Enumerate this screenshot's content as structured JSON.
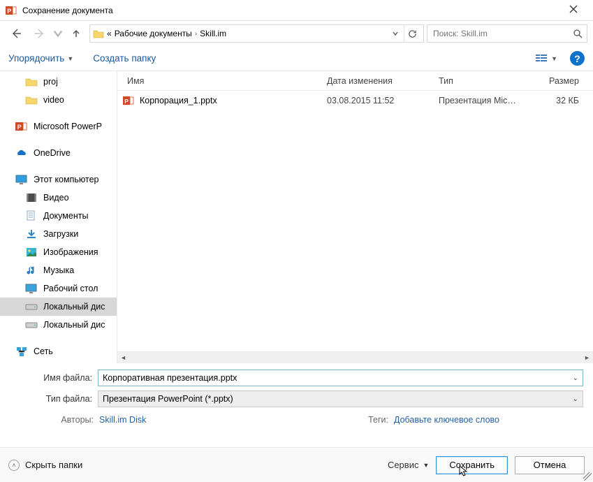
{
  "window": {
    "title": "Сохранение документа"
  },
  "nav": {
    "crumb_prefix": "«",
    "crumb1": "Рабочие документы",
    "crumb2": "Skill.im",
    "search_placeholder": "Поиск: Skill.im"
  },
  "toolbar": {
    "organize": "Упорядочить",
    "new_folder": "Создать папку",
    "help": "?"
  },
  "tree": {
    "n_proj": "proj",
    "n_video": "video",
    "n_ppt": "Microsoft PowerP",
    "n_onedrive": "OneDrive",
    "n_thispc": "Этот компьютер",
    "n_video2": "Видео",
    "n_docs": "Документы",
    "n_dl": "Загрузки",
    "n_img": "Изображения",
    "n_music": "Музыка",
    "n_desk": "Рабочий стол",
    "n_disk1": "Локальный дис",
    "n_disk2": "Локальный дис",
    "n_net": "Сеть"
  },
  "columns": {
    "name": "Имя",
    "date": "Дата изменения",
    "type": "Тип",
    "size": "Размер"
  },
  "files": [
    {
      "name": "Корпорация_1.pptx",
      "date": "03.08.2015 11:52",
      "type": "Презентация Mic…",
      "size": "32 КБ"
    }
  ],
  "form": {
    "filename_label": "Имя файла:",
    "filename_value": "Корпоративная презентация.pptx",
    "filetype_label": "Тип файла:",
    "filetype_value": "Презентация PowerPoint (*.pptx)",
    "authors_label": "Авторы:",
    "authors_value": "Skill.im Disk",
    "tags_label": "Теги:",
    "tags_value": "Добавьте ключевое слово"
  },
  "footer": {
    "hide_folders": "Скрыть папки",
    "service": "Сервис",
    "save": "Сохранить",
    "cancel": "Отмена"
  }
}
